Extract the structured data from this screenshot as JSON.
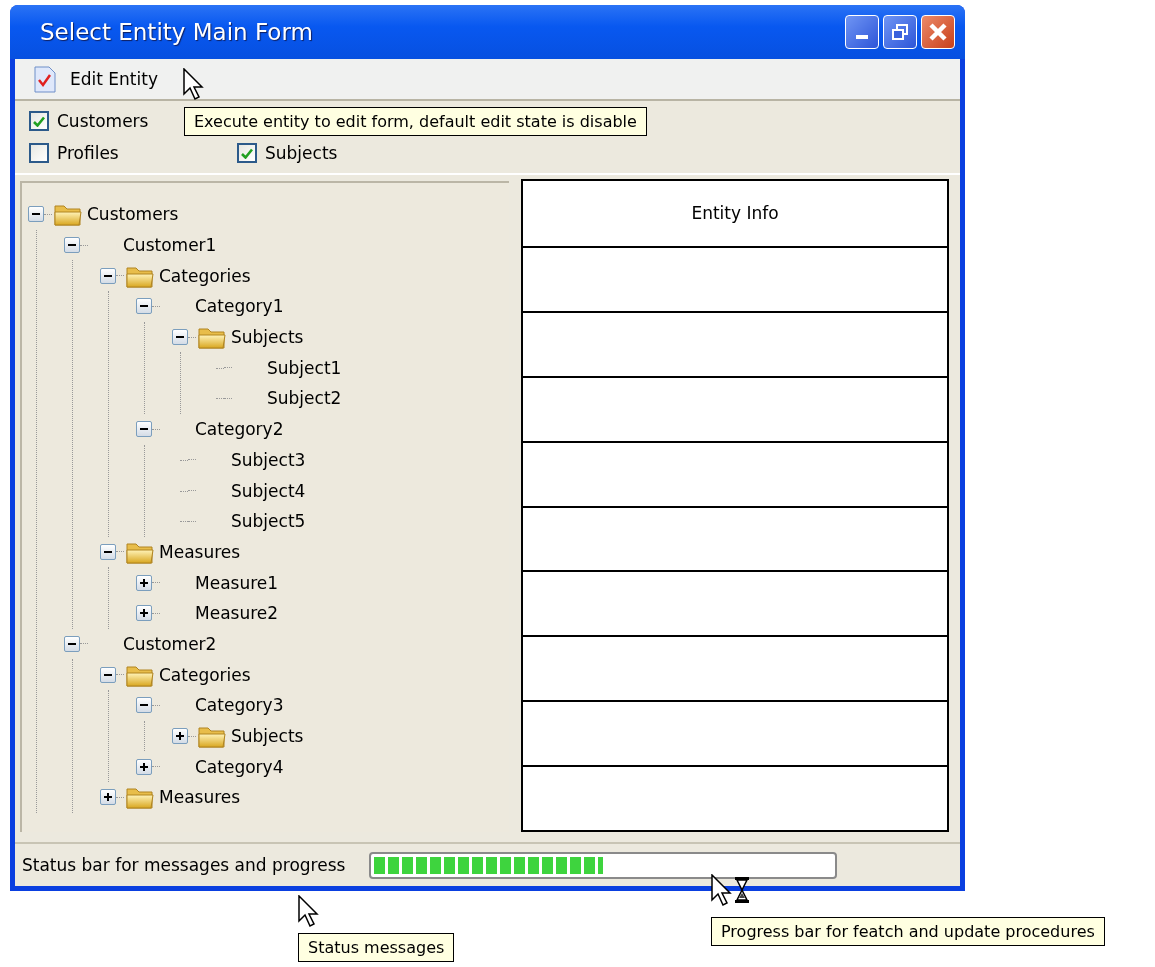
{
  "window": {
    "title": "Select Entity Main Form"
  },
  "toolbar": {
    "button": "Edit Entity"
  },
  "filters": [
    [
      {
        "label": "Customers",
        "checked": true
      }
    ],
    [
      {
        "label": "Profiles",
        "checked": false
      },
      {
        "label": "Subjects",
        "checked": true
      }
    ]
  ],
  "tree": [
    {
      "label": "Customers",
      "folder": true,
      "expanded": true,
      "children": [
        {
          "label": "Customer1",
          "folder": false,
          "expanded": true,
          "children": [
            {
              "label": "Categories",
              "folder": true,
              "expanded": true,
              "children": [
                {
                  "label": "Category1",
                  "folder": false,
                  "expanded": true,
                  "children": [
                    {
                      "label": "Subjects",
                      "folder": true,
                      "expanded": true,
                      "children": [
                        {
                          "label": "Subject1",
                          "folder": false
                        },
                        {
                          "label": "Subject2",
                          "folder": false
                        }
                      ]
                    }
                  ]
                },
                {
                  "label": "Category2",
                  "folder": false,
                  "expanded": true,
                  "children": [
                    {
                      "label": "Subject3",
                      "folder": false
                    },
                    {
                      "label": "Subject4",
                      "folder": false
                    },
                    {
                      "label": "Subject5",
                      "folder": false
                    }
                  ]
                }
              ]
            },
            {
              "label": "Measures",
              "folder": true,
              "expanded": true,
              "children": [
                {
                  "label": "Measure1",
                  "folder": false,
                  "expanded": false
                },
                {
                  "label": "Measure2",
                  "folder": false,
                  "expanded": false
                }
              ]
            }
          ]
        },
        {
          "label": "Customer2",
          "folder": false,
          "expanded": true,
          "children": [
            {
              "label": "Categories",
              "folder": true,
              "expanded": true,
              "children": [
                {
                  "label": "Category3",
                  "folder": false,
                  "expanded": true,
                  "children": [
                    {
                      "label": "Subjects",
                      "folder": true,
                      "expanded": false
                    }
                  ]
                },
                {
                  "label": "Category4",
                  "folder": false,
                  "expanded": false
                }
              ]
            },
            {
              "label": "Measures",
              "folder": true,
              "expanded": false
            }
          ]
        }
      ]
    }
  ],
  "entity_info": {
    "title": "Entity Info"
  },
  "status_bar": {
    "message": "Status bar for messages and progress",
    "progress": {
      "level": 0.5
    }
  },
  "annotations": [
    {
      "text": "Execute entity to edit form, default edit state is disable",
      "kind": "tooltip"
    },
    {
      "text": "Status messages",
      "kind": "tooltip"
    },
    {
      "text": "Progress bar for featch and update procedures",
      "kind": "tooltip"
    }
  ]
}
